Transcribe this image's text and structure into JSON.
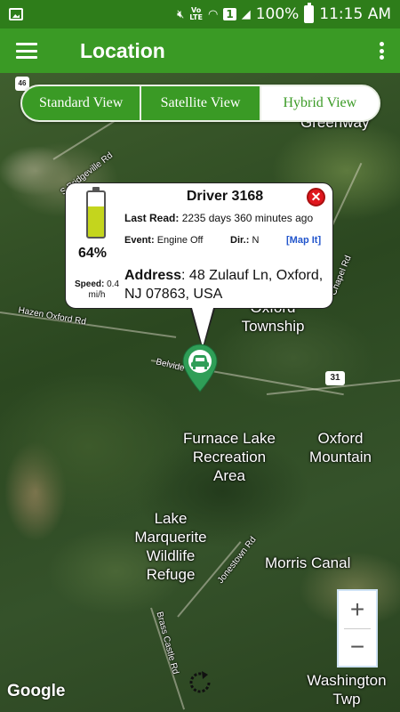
{
  "status_bar": {
    "lte_label": "Vo\nLTE",
    "sim_label": "1",
    "battery": "100%",
    "time": "11:15 AM"
  },
  "app_bar": {
    "title": "Location"
  },
  "view_toggle": {
    "options": [
      "Standard View",
      "Satellite View",
      "Hybrid View"
    ],
    "selected": "Satellite View"
  },
  "info_window": {
    "driver": "Driver 3168",
    "battery_pct": "64%",
    "battery_level": 0.64,
    "last_read_label": "Last Read:",
    "last_read_value": "2235 days 360 minutes  ago",
    "event_label": "Event:",
    "event_value": "Engine Off",
    "dir_label": "Dir.:",
    "dir_value": "N",
    "map_it": "[Map It]",
    "speed_label": "Speed:",
    "speed_value": "0.4 mi/h",
    "address_label": "Address",
    "address_value": ": 48 Zulauf Ln, Oxford, NJ 07863, USA"
  },
  "map_labels": {
    "oxford_township": "Oxford\nTownship",
    "furnace_lake": "Furnace Lake\nRecreation\nArea",
    "oxford_mountain": "Oxford\nMountain",
    "lake_marquerite": "Lake\nMarquerite\nWildlife\nRefuge",
    "morris_canal": "Morris Canal",
    "washington_twp": "Washington\nTwp",
    "greenway": "er\nGreenway",
    "route_31": "31",
    "route_shield": "46"
  },
  "road_labels": {
    "s_bridgeville": "S Bridgeville Rd",
    "hazen_oxford": "Hazen Oxford Rd",
    "belvidere": "Belvide",
    "chapel": "Chapel Rd",
    "jonestown": "Jonestown Rd",
    "brass_castle": "Brass Castle Rd"
  },
  "zoom": {
    "in": "+",
    "out": "−"
  },
  "attribution": "Google",
  "colors": {
    "primary": "#3a9a25",
    "status_bar": "#2e7d1a",
    "marker": "#2f9e57",
    "close": "#e0161d",
    "map_it": "#2255cc"
  }
}
